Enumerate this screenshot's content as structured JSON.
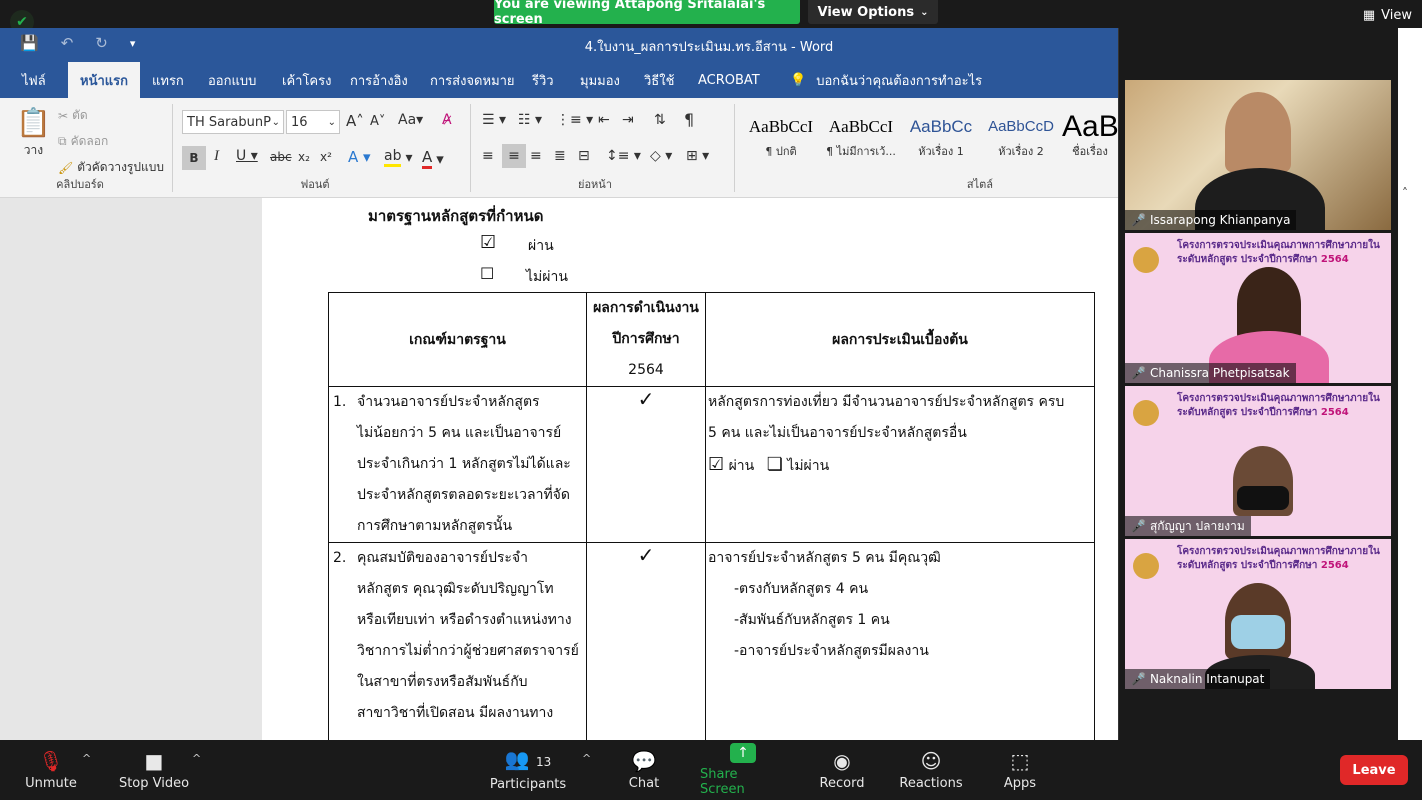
{
  "zoom_top": {
    "share_banner": "You are viewing Attapong Sritalalai's screen",
    "view_options": "View Options",
    "view_label": "View"
  },
  "word": {
    "title": "4.ใบงาน_ผลการประเมินม.ทร.อีสาน  -  Word",
    "tabs": [
      "ไฟล์",
      "หน้าแรก",
      "แทรก",
      "ออกแบบ",
      "เค้าโครง",
      "การอ้างอิง",
      "การส่งจดหมาย",
      "รีวิว",
      "มุมมอง",
      "วิธีใช้",
      "ACROBAT"
    ],
    "tell_me": "บอกฉันว่าคุณต้องการทำอะไร",
    "clipboard": {
      "paste": "วาง",
      "cut": "ตัด",
      "copy": "คัดลอก",
      "format_painter": "ตัวคัดวางรูปแบบ",
      "label": "คลิปบอร์ด"
    },
    "font": {
      "name": "TH SarabunP",
      "size": "16",
      "label": "ฟอนต์"
    },
    "paragraph_label": "ย่อหน้า",
    "styles": {
      "label": "สไตล์",
      "items": [
        {
          "sample": "AaBbCcI",
          "name": "¶ ปกติ"
        },
        {
          "sample": "AaBbCcI",
          "name": "¶ ไม่มีการเว้..."
        },
        {
          "sample": "AaBbCc",
          "name": "หัวเรื่อง 1"
        },
        {
          "sample": "AaBbCcD",
          "name": "หัวเรื่อง 2"
        },
        {
          "sample": "AaB",
          "name": "ชื่อเรื่อง"
        }
      ]
    }
  },
  "document": {
    "heading": "มาตรฐานหลักสูตรที่กำหนด",
    "option_pass": "ผ่าน",
    "option_fail": "ไม่ผ่าน",
    "table": {
      "headers": [
        "เกณฑ์มาตรฐาน",
        "ผลการดำเนินงาน",
        "ปีการศึกษา",
        "2564",
        "ผลการประเมินเบื้องต้น"
      ],
      "rows": [
        {
          "num": "1.",
          "criteria": [
            "จำนวนอาจารย์ประจำหลักสูตร",
            "ไม่น้อยกว่า 5 คน และเป็นอาจารย์",
            "ประจำเกินกว่า 1 หลักสูตรไม่ได้และ",
            "ประจำหลักสูตรตลอดระยะเวลาที่จัด",
            "การศึกษาตามหลักสูตรนั้น"
          ],
          "check": "✓",
          "result": [
            "หลักสูตรการท่องเที่ยว มีจำนวนอาจารย์ประจำหลักสูตร ครบ",
            "5 คน และไม่เป็นอาจารย์ประจำหลักสูตรอื่น"
          ],
          "pass_label": "ผ่าน",
          "fail_label": "ไม่ผ่าน"
        },
        {
          "num": "2.",
          "criteria": [
            "คุณสมบัติของอาจารย์ประจำ",
            "หลักสูตร คุณวุฒิระดับปริญญาโท",
            "หรือเทียบเท่า หรือดำรงตำแหน่งทาง",
            "วิชาการไม่ต่ำกว่าผู้ช่วยศาสตราจารย์",
            "ในสาขาที่ตรงหรือสัมพันธ์กับ",
            "สาขาวิชาที่เปิดสอน มีผลงานทาง"
          ],
          "check": "✓",
          "result": [
            "อาจารย์ประจำหลักสูตร 5 คน มีคุณวุฒิ",
            "-ตรงกับหลักสูตร 4 คน",
            "-สัมพันธ์กับหลักสูตร 1 คน",
            "-อาจารย์ประจำหลักสูตรมีผลงาน"
          ]
        }
      ]
    }
  },
  "participants_panel": {
    "tiles": [
      {
        "name": "Issarapong Khianpanya"
      },
      {
        "name": "Chanissra Phetpisatsak",
        "banner_line1": "โครงการตรวจประเมินคุณภาพการศึกษาภายใน",
        "banner_line2": "ระดับหลักสูตร ประจำปีการศึกษา",
        "banner_year": "2564"
      },
      {
        "name": "สุกัญญา ปลายงาม",
        "banner_line1": "โครงการตรวจประเมินคุณภาพการศึกษาภายใน",
        "banner_line2": "ระดับหลักสูตร ประจำปีการศึกษา",
        "banner_year": "2564"
      },
      {
        "name": "Naknalin Intanupat",
        "banner_line1": "โครงการตรวจประเมินคุณภาพการศึกษาภายใน",
        "banner_line2": "ระดับหลักสูตร ประจำปีการศึกษา",
        "banner_year": "2564"
      }
    ]
  },
  "zoom_bottom": {
    "unmute": "Unmute",
    "stop_video": "Stop Video",
    "participants": "Participants",
    "participant_count": "13",
    "chat": "Chat",
    "share_screen": "Share Screen",
    "record": "Record",
    "reactions": "Reactions",
    "apps": "Apps",
    "leave": "Leave"
  },
  "colors": {
    "word_blue": "#2b579a",
    "zoom_green": "#23b14d",
    "leave_red": "#e02828"
  }
}
